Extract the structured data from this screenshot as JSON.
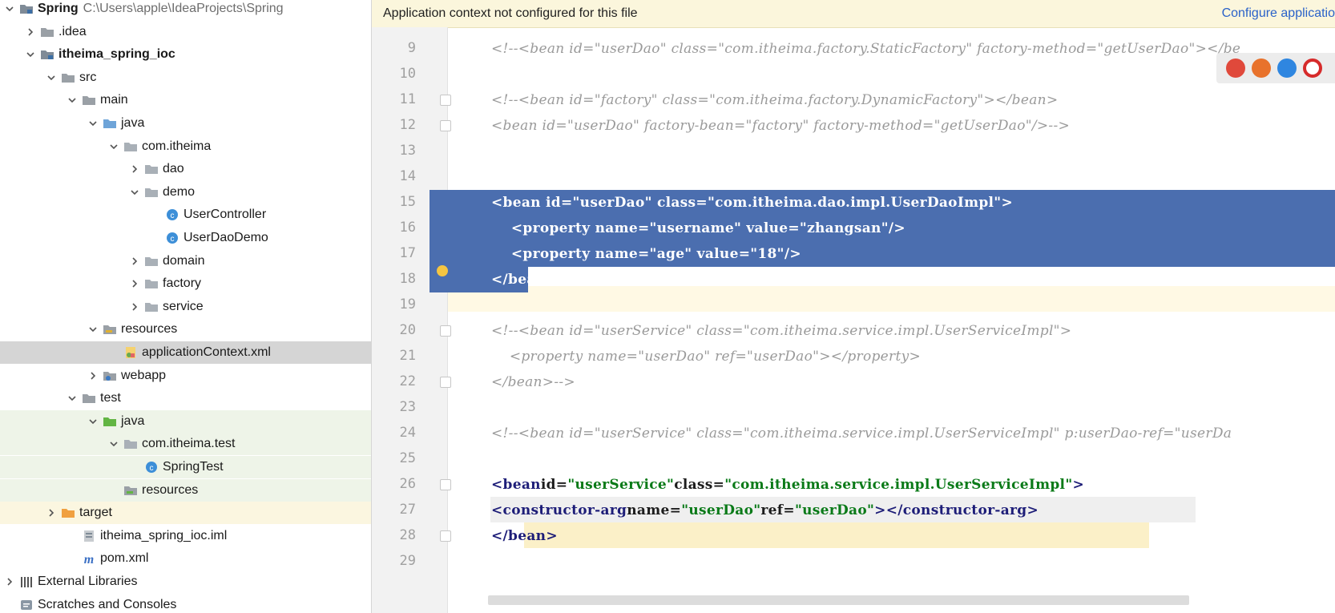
{
  "tree": {
    "items": [
      {
        "label": "Spring",
        "path": "C:\\Users\\apple\\IdeaProjects\\Spring",
        "bold": true,
        "icon": "module-folder-icon",
        "arrow": "down"
      },
      {
        "label": ".idea",
        "icon": "folder-icon",
        "arrow": "right"
      },
      {
        "label": "itheima_spring_ioc",
        "bold": true,
        "icon": "module-folder-icon",
        "arrow": "down"
      },
      {
        "label": "src",
        "icon": "folder-icon",
        "arrow": "down"
      },
      {
        "label": "main",
        "icon": "folder-icon",
        "arrow": "down"
      },
      {
        "label": "java",
        "icon": "source-folder-icon",
        "arrow": "down"
      },
      {
        "label": "com.itheima",
        "icon": "package-icon",
        "arrow": "down"
      },
      {
        "label": "dao",
        "icon": "package-icon",
        "arrow": "right"
      },
      {
        "label": "demo",
        "icon": "package-icon",
        "arrow": "down"
      },
      {
        "label": "UserController",
        "icon": "java-class-icon"
      },
      {
        "label": "UserDaoDemo",
        "icon": "java-class-icon"
      },
      {
        "label": "domain",
        "icon": "package-icon",
        "arrow": "right"
      },
      {
        "label": "factory",
        "icon": "package-icon",
        "arrow": "right"
      },
      {
        "label": "service",
        "icon": "package-icon",
        "arrow": "right"
      },
      {
        "label": "resources",
        "icon": "resources-folder-icon",
        "arrow": "down"
      },
      {
        "label": "applicationContext.xml",
        "icon": "xml-file-icon",
        "selected": true
      },
      {
        "label": "webapp",
        "icon": "web-folder-icon",
        "arrow": "right"
      },
      {
        "label": "test",
        "icon": "folder-icon",
        "arrow": "down"
      },
      {
        "label": "java",
        "icon": "test-source-folder-icon",
        "arrow": "down",
        "testbg": true
      },
      {
        "label": "com.itheima.test",
        "icon": "package-icon",
        "arrow": "down",
        "testbg": true
      },
      {
        "label": "SpringTest",
        "icon": "java-class-icon",
        "testbg": true
      },
      {
        "label": "resources",
        "icon": "test-resources-folder-icon",
        "testbg": true
      },
      {
        "label": "target",
        "icon": "excluded-folder-icon",
        "arrow": "right",
        "targetbg": true
      },
      {
        "label": "itheima_spring_ioc.iml",
        "icon": "iml-file-icon"
      },
      {
        "label": "pom.xml",
        "icon": "maven-file-icon"
      },
      {
        "label": "External Libraries",
        "icon": "libraries-icon",
        "arrow": "right"
      },
      {
        "label": "Scratches and Consoles",
        "icon": "scratches-icon"
      }
    ]
  },
  "editor": {
    "banner": {
      "message": "Application context not configured for this file",
      "link": "Configure applicatio"
    },
    "lines": [
      {
        "num": "9",
        "text": "<!--<bean id=\"userDao\" class=\"com.itheima.factory.StaticFactory\" factory-method=\"getUserDao\"></be",
        "kind": "comment"
      },
      {
        "num": "10",
        "text": "",
        "kind": "plain"
      },
      {
        "num": "11",
        "text": "<!--<bean id=\"factory\" class=\"com.itheima.factory.DynamicFactory\"></bean>",
        "kind": "comment"
      },
      {
        "num": "12",
        "text": "<bean id=\"userDao\" factory-bean=\"factory\" factory-method=\"getUserDao\"/>-->",
        "kind": "comment"
      },
      {
        "num": "13",
        "text": "",
        "kind": "plain"
      },
      {
        "num": "14",
        "text": "",
        "kind": "plain"
      },
      {
        "num": "15",
        "text": "<bean id=\"userDao\" class=\"com.itheima.dao.impl.UserDaoImpl\">",
        "kind": "selected"
      },
      {
        "num": "16",
        "text": "    <property name=\"username\" value=\"zhangsan\"/>",
        "kind": "selected"
      },
      {
        "num": "17",
        "text": "    <property name=\"age\" value=\"18\"/>",
        "kind": "selected"
      },
      {
        "num": "18",
        "text": "</bean>",
        "kind": "selected"
      },
      {
        "num": "19",
        "text": "",
        "kind": "plain"
      },
      {
        "num": "20",
        "text": "<!--<bean id=\"userService\" class=\"com.itheima.service.impl.UserServiceImpl\">",
        "kind": "comment"
      },
      {
        "num": "21",
        "text": "    <property name=\"userDao\" ref=\"userDao\"></property>",
        "kind": "comment"
      },
      {
        "num": "22",
        "text": "</bean>-->",
        "kind": "comment"
      },
      {
        "num": "23",
        "text": "",
        "kind": "plain"
      },
      {
        "num": "24",
        "text": "<!--<bean id=\"userService\" class=\"com.itheima.service.impl.UserServiceImpl\" p:userDao-ref=\"userDa",
        "kind": "comment"
      },
      {
        "num": "25",
        "text": "",
        "kind": "plain"
      },
      {
        "num": "26",
        "text": "<bean id=\"userService\" class=\"com.itheima.service.impl.UserServiceImpl\">",
        "kind": "code"
      },
      {
        "num": "27",
        "text": "    <constructor-arg name=\"userDao\" ref=\"userDao\"></constructor-arg>",
        "kind": "code"
      },
      {
        "num": "28",
        "text": "</bean>",
        "kind": "code"
      },
      {
        "num": "29",
        "text": "",
        "kind": "plain"
      }
    ]
  },
  "colors": {
    "selection": "#4b6eaf",
    "banner_bg": "#fbf6dc",
    "link": "#2a62c9",
    "comment": "#9a9a9a",
    "xml_tag": "#1d1d78",
    "xml_value": "#0a7a18"
  },
  "browsers": [
    "chrome-icon",
    "firefox-icon",
    "safari-icon",
    "opera-icon"
  ]
}
